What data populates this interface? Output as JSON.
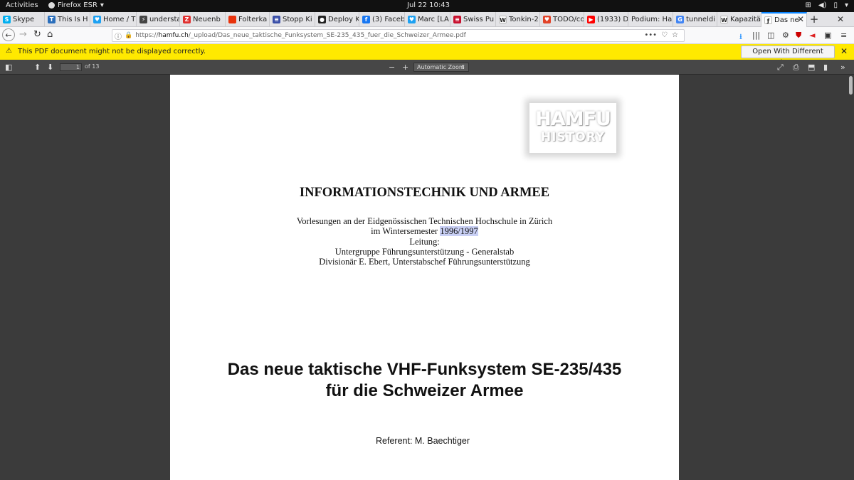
{
  "gnome": {
    "activities": "Activities",
    "app": "Firefox ESR",
    "clock": "Jul 22  10:43"
  },
  "tabs": [
    {
      "label": "Skype",
      "icon": "skype-icon",
      "color": "#00aff0",
      "g": "S"
    },
    {
      "label": "This Is H",
      "icon": "site-icon",
      "color": "#2a6ebb",
      "g": "T"
    },
    {
      "label": "Home / T",
      "icon": "twitter-icon",
      "color": "#1da1f2",
      "g": "♥"
    },
    {
      "label": "understa",
      "icon": "bolt-icon",
      "color": "#444",
      "g": "⚡"
    },
    {
      "label": "Neuenb",
      "icon": "z-icon",
      "color": "#e03030",
      "g": "Z"
    },
    {
      "label": "Folterka",
      "icon": "red-square-icon",
      "color": "#e8320c",
      "g": ""
    },
    {
      "label": "Stopp Ki",
      "icon": "bars-icon",
      "color": "#3a4fa8",
      "g": "≡"
    },
    {
      "label": "Deploy K",
      "icon": "github-icon",
      "color": "#222",
      "g": "●"
    },
    {
      "label": "(3) Faceb",
      "icon": "facebook-icon",
      "color": "#1877f2",
      "g": "f"
    },
    {
      "label": "Marc [LA",
      "icon": "twitter-icon",
      "color": "#1da1f2",
      "g": "♥"
    },
    {
      "label": "Swiss Pu",
      "icon": "swiss-icon",
      "color": "#c8102e",
      "g": "≡"
    },
    {
      "label": "Tonkin-2",
      "icon": "wikipedia-icon",
      "color": "#fff",
      "g": "W"
    },
    {
      "label": "TODO/co",
      "icon": "gitlab-icon",
      "color": "#e24329",
      "g": "♥"
    },
    {
      "label": "(1933) De",
      "icon": "youtube-icon",
      "color": "#ff0000",
      "g": "▶"
    },
    {
      "label": "Podium: Ha",
      "icon": "",
      "color": "",
      "g": ""
    },
    {
      "label": "tunneldi",
      "icon": "google-icon",
      "color": "#4285f4",
      "g": "G"
    },
    {
      "label": "Kapazitä",
      "icon": "wikipedia-icon",
      "color": "#fff",
      "g": "W"
    },
    {
      "label": "Das ne",
      "icon": "pdf-icon",
      "color": "#fff",
      "g": "ƒ"
    }
  ],
  "url": {
    "prefix": "https://",
    "host": "hamfu.ch",
    "path": "/_upload/Das_neue_taktische_Funksystem_SE-235_435_fuer_die_Schweizer_Armee.pdf"
  },
  "notice": {
    "text": "This PDF document might not be displayed correctly.",
    "button": "Open With Different Viewer"
  },
  "pdf": {
    "page": "1",
    "of": "of 13",
    "zoom": "Automatic Zoom"
  },
  "document": {
    "logo_line1": "HAMFU",
    "logo_line2": "HISTORY",
    "title": "INFORMATIONSTECHNIK UND ARMEE",
    "line1": "Vorlesungen an der Eidgenössischen Technischen Hochschule in Zürich",
    "line2_prefix": "im Wintersemester ",
    "line2_highlight": "1996/1997",
    "line3": "Leitung:",
    "line4": "Untergruppe Führungsunterstützung - Generalstab",
    "line5": "Divisionär  E. Ebert, Unterstabschef Führungsunterstützung",
    "big_title_1": "Das neue taktische VHF-Funksystem SE-235/435",
    "big_title_2": "für die Schweizer Armee",
    "referent": "Referent:  M. Baechtiger"
  }
}
